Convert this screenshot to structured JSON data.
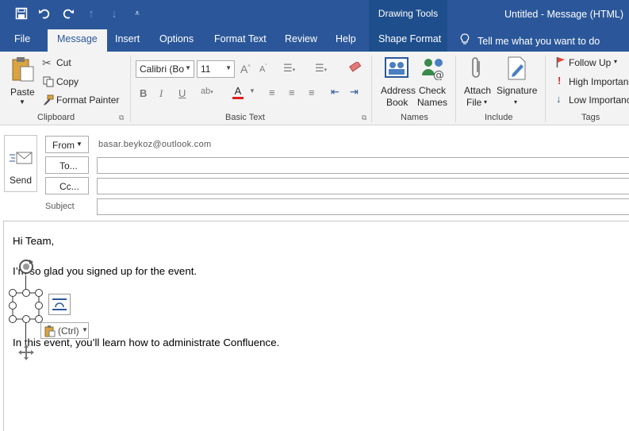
{
  "qat": {
    "save": "save-icon",
    "undo": "undo-icon",
    "redo": "redo-icon",
    "up": "up-icon",
    "down": "down-icon",
    "customize": "customize-icon"
  },
  "titlebar": {
    "context_tab": "Drawing Tools",
    "window_title": "Untitled  -  Message (HTML)"
  },
  "tabs": [
    "File",
    "Message",
    "Insert",
    "Options",
    "Format Text",
    "Review",
    "Help",
    "Shape Format"
  ],
  "tell_me": "Tell me what you want to do",
  "clipboard": {
    "paste": "Paste",
    "cut": "Cut",
    "copy": "Copy",
    "format_painter": "Format Painter",
    "label": "Clipboard"
  },
  "basic_text": {
    "font": "Calibri (Bo",
    "size": "11",
    "label": "Basic Text"
  },
  "names": {
    "address_book_1": "Address",
    "address_book_2": "Book",
    "check_names_1": "Check",
    "check_names_2": "Names",
    "label": "Names"
  },
  "include": {
    "attach_1": "Attach",
    "attach_2": "File",
    "signature": "Signature",
    "label": "Include"
  },
  "tags": {
    "follow_up": "Follow Up",
    "high": "High Importance",
    "low": "Low Importance",
    "label": "Tags"
  },
  "header": {
    "send": "Send",
    "from_btn": "From",
    "from_addr": "basar.beykoz@outlook.com",
    "to_btn": "To...",
    "cc_btn": "Cc...",
    "subject_label": "Subject"
  },
  "body": {
    "line1": "Hi Team,",
    "line2": "I’m so glad you signed up for the event.",
    "line3": "In this event, you’ll learn how to administrate Confluence.",
    "paste_options": "(Ctrl)"
  },
  "colors": {
    "accent": "#2b579a",
    "contextual": "#1e4e8c",
    "ribbon_bg": "#f3f3f3"
  }
}
